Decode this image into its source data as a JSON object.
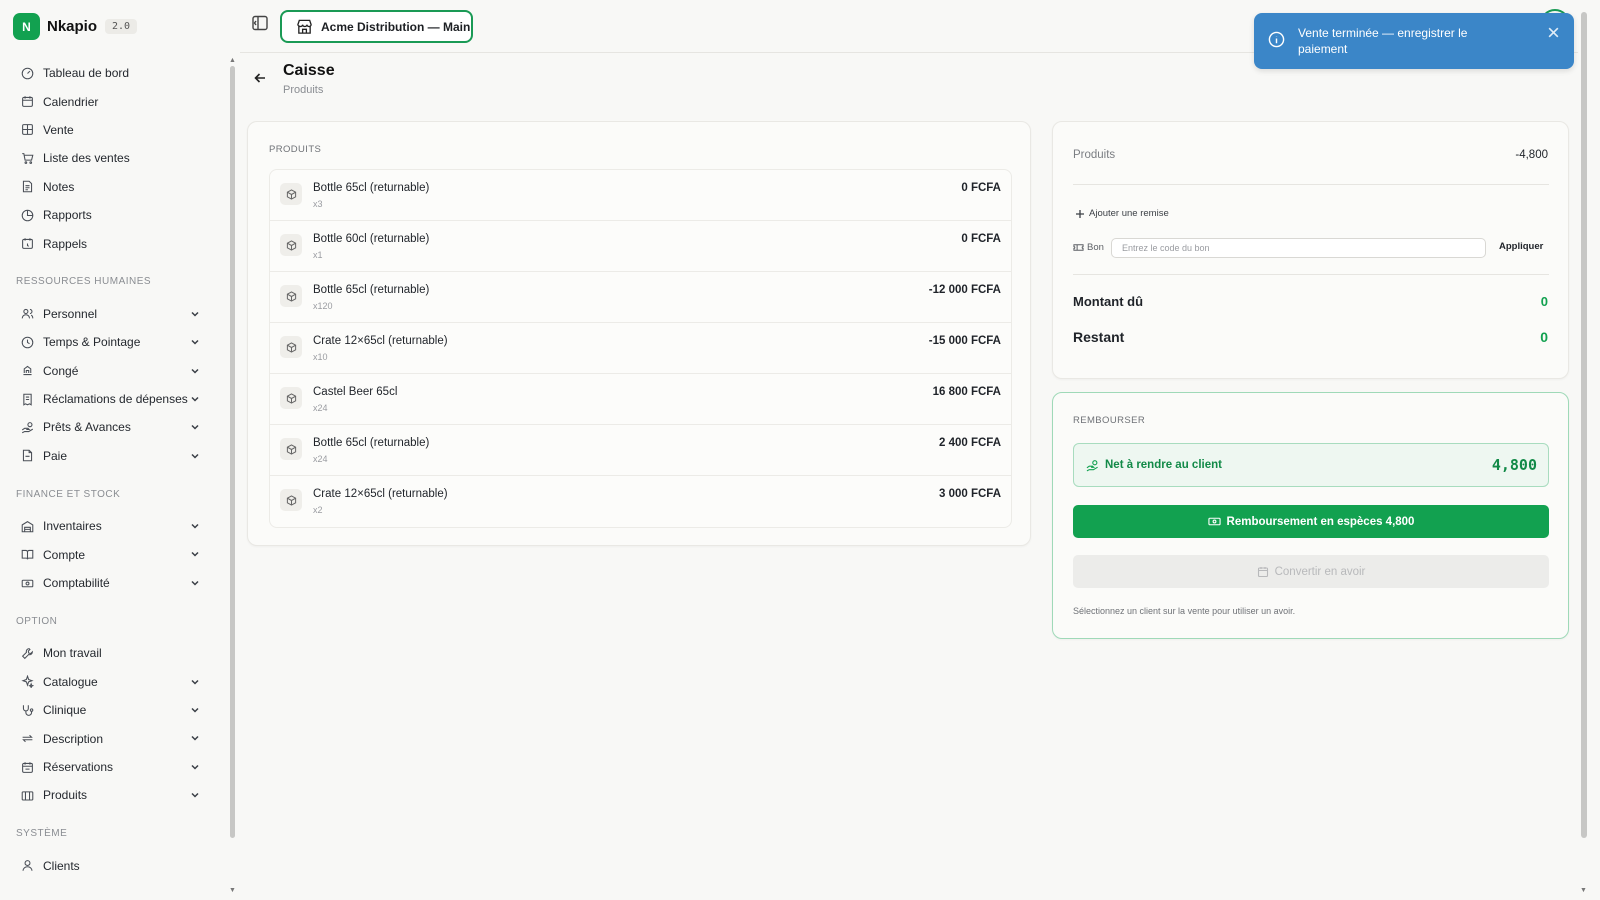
{
  "app": {
    "name": "Nkapio",
    "version": "2.0",
    "logo_letter": "N",
    "brand_color": "#12a150"
  },
  "store_selector": {
    "label": "Acme Distribution — Main",
    "icon": "store-icon"
  },
  "toast": {
    "message": "Vente terminée — enregistrer le paiement",
    "color": "#3b86c8",
    "icon": "info-icon"
  },
  "sidebar": {
    "main_items": [
      {
        "label": "Tableau de bord",
        "icon": "dashboard-icon"
      },
      {
        "label": "Calendrier",
        "icon": "calendar-icon"
      },
      {
        "label": "Vente",
        "icon": "grid-icon"
      },
      {
        "label": "Liste des ventes",
        "icon": "cart-icon"
      },
      {
        "label": "Notes",
        "icon": "note-icon"
      },
      {
        "label": "Rapports",
        "icon": "pie-chart-icon"
      },
      {
        "label": "Rappels",
        "icon": "reminder-icon"
      }
    ],
    "sections": [
      {
        "title": "RESSOURCES HUMAINES",
        "items": [
          {
            "label": "Personnel",
            "icon": "users-icon"
          },
          {
            "label": "Temps & Pointage",
            "icon": "clock-icon"
          },
          {
            "label": "Congé",
            "icon": "plane-icon"
          },
          {
            "label": "Réclamations de dépenses",
            "icon": "receipt-icon"
          },
          {
            "label": "Prêts & Avances",
            "icon": "hand-coins-icon"
          },
          {
            "label": "Paie",
            "icon": "payslip-icon"
          }
        ]
      },
      {
        "title": "FINANCE ET STOCK",
        "items": [
          {
            "label": "Inventaires",
            "icon": "warehouse-icon"
          },
          {
            "label": "Compte",
            "icon": "book-icon"
          },
          {
            "label": "Comptabilité",
            "icon": "banknote-icon"
          }
        ]
      },
      {
        "title": "OPTION",
        "items": [
          {
            "label": "Mon travail",
            "icon": "wrench-icon"
          },
          {
            "label": "Catalogue",
            "icon": "sparkle-icon"
          },
          {
            "label": "Clinique",
            "icon": "stethoscope-icon"
          },
          {
            "label": "Description",
            "icon": "repeat-icon"
          },
          {
            "label": "Réservations",
            "icon": "calendar-check-icon"
          },
          {
            "label": "Produits",
            "icon": "box-icon"
          }
        ]
      },
      {
        "title": "SYSTÈME",
        "items": [
          {
            "label": "Clients",
            "icon": "user-icon"
          }
        ]
      }
    ]
  },
  "page": {
    "title": "Caisse",
    "subtitle": "Produits"
  },
  "products": {
    "section_label": "PRODUITS",
    "items": [
      {
        "name": "Bottle 65cl (returnable)",
        "qty": "x3",
        "price": "0 FCFA"
      },
      {
        "name": "Bottle 60cl (returnable)",
        "qty": "x1",
        "price": "0 FCFA"
      },
      {
        "name": "Bottle 65cl (returnable)",
        "qty": "x120",
        "price": "-12 000 FCFA"
      },
      {
        "name": "Crate 12×65cl (returnable)",
        "qty": "x10",
        "price": "-15 000 FCFA"
      },
      {
        "name": "Castel Beer 65cl",
        "qty": "x24",
        "price": "16 800 FCFA"
      },
      {
        "name": "Bottle 65cl (returnable)",
        "qty": "x24",
        "price": "2 400 FCFA"
      },
      {
        "name": "Crate 12×65cl (returnable)",
        "qty": "x2",
        "price": "3 000 FCFA"
      }
    ]
  },
  "summary": {
    "products_label": "Produits",
    "products_value": "-4,800",
    "add_discount": "Ajouter une remise",
    "voucher_label": "Bon",
    "voucher_placeholder": "Entrez le code du bon",
    "voucher_value": "",
    "apply": "Appliquer",
    "amount_due_label": "Montant dû",
    "amount_due_value": "0",
    "remaining_label": "Restant",
    "remaining_value": "0"
  },
  "refund": {
    "section_label": "REMBOURSER",
    "net_label": "Net à rendre au client",
    "net_value": "4,800",
    "cash_button": "Remboursement en espèces 4,800",
    "credit_button": "Convertir en avoir",
    "hint": "Sélectionnez un client sur la vente pour utiliser un avoir."
  }
}
